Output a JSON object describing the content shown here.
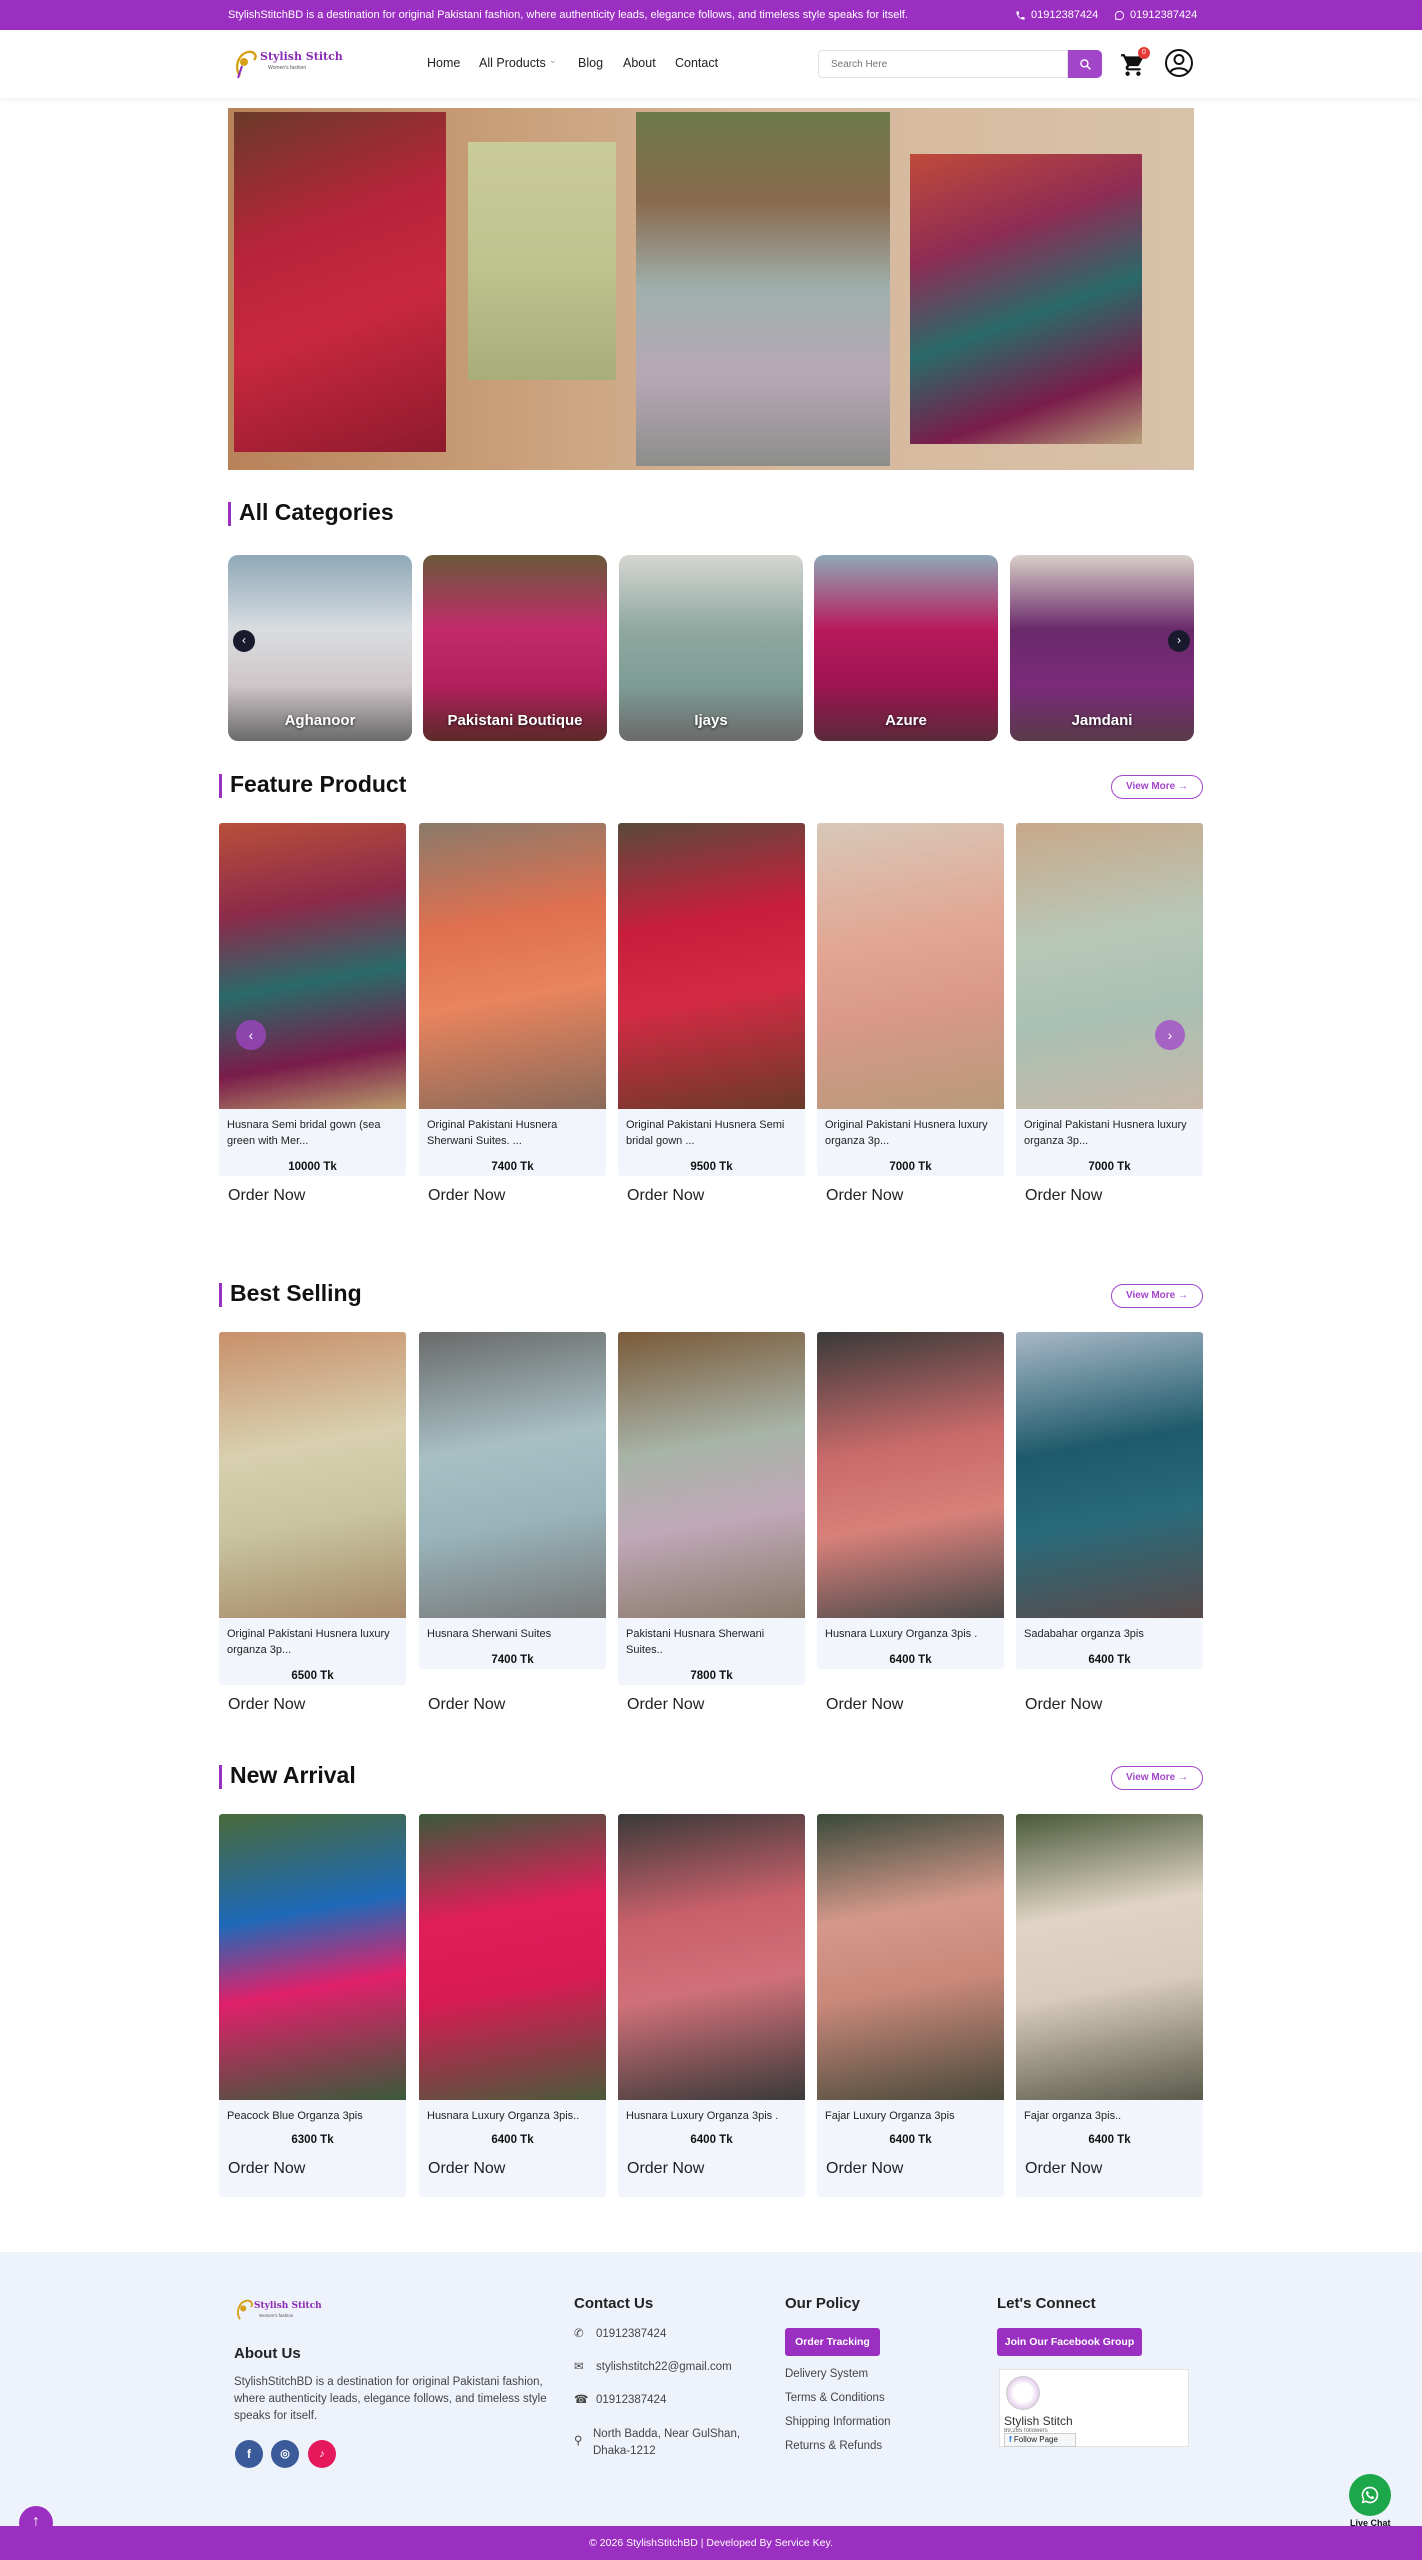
{
  "topbar": {
    "message": "StylishStitchBD is a destination for original Pakistani fashion, where authenticity leads, elegance follows, and timeless style speaks for itself.",
    "phone": "01912387424",
    "whatsapp": "01912387424"
  },
  "header": {
    "logo_text": "Stylish Stitch",
    "logo_sub": "Women's fashion",
    "nav": [
      "Home",
      "All Products",
      "Blog",
      "About",
      "Contact"
    ],
    "search_placeholder": "Search Here",
    "cart_count": "0"
  },
  "categories": {
    "title": "All Categories",
    "items": [
      "Aghanoor",
      "Pakistani Boutique",
      "Ijays",
      "Azure",
      "Jamdani"
    ]
  },
  "feature": {
    "title": "Feature Product",
    "view_more": "View More →",
    "products": [
      {
        "name": "Husnara Semi bridal gown (sea green with Mer...",
        "price": "10000 Tk",
        "order": "Order Now"
      },
      {
        "name": "Original Pakistani Husnera Sherwani Suites. ...",
        "price": "7400 Tk",
        "order": "Order Now"
      },
      {
        "name": "Original Pakistani Husnera Semi bridal gown ...",
        "price": "9500 Tk",
        "order": "Order Now"
      },
      {
        "name": "Original Pakistani Husnera luxury organza 3p...",
        "price": "7000 Tk",
        "order": "Order Now"
      },
      {
        "name": "Original Pakistani Husnera luxury organza 3p...",
        "price": "7000 Tk",
        "order": "Order Now"
      }
    ]
  },
  "best": {
    "title": "Best Selling",
    "view_more": "View More →",
    "products": [
      {
        "name": "Original Pakistani Husnera luxury organza 3p...",
        "price": "6500 Tk",
        "order": "Order Now"
      },
      {
        "name": "Husnara Sherwani Suites",
        "price": "7400 Tk",
        "order": "Order Now"
      },
      {
        "name": "Pakistani Husnara Sherwani Suites..",
        "price": "7800 Tk",
        "order": "Order Now"
      },
      {
        "name": "Husnara Luxury Organza 3pis .",
        "price": "6400 Tk",
        "order": "Order Now"
      },
      {
        "name": "Sadabahar organza 3pis",
        "price": "6400 Tk",
        "order": "Order Now"
      }
    ]
  },
  "arrival": {
    "title": "New Arrival",
    "view_more": "View More →",
    "products": [
      {
        "name": "Peacock Blue Organza 3pis",
        "price": "6300 Tk",
        "order": "Order Now"
      },
      {
        "name": "Husnara Luxury Organza 3pis..",
        "price": "6400 Tk",
        "order": "Order Now"
      },
      {
        "name": "Husnara Luxury Organza 3pis .",
        "price": "6400 Tk",
        "order": "Order Now"
      },
      {
        "name": "Fajar Luxury Organza 3pis",
        "price": "6400 Tk",
        "order": "Order Now"
      },
      {
        "name": "Fajar organza 3pis..",
        "price": "6400 Tk",
        "order": "Order Now"
      }
    ]
  },
  "footer": {
    "about_title": "About Us",
    "about_text": "StylishStitchBD is a destination for original Pakistani fashion, where authenticity leads, elegance follows, and timeless style speaks for itself.",
    "contact_title": "Contact Us",
    "whatsapp": "01912387424",
    "email": "stylishstitch22@gmail.com",
    "phone": "01912387424",
    "address": "North Badda, Near GulShan, Dhaka-1212",
    "policy_title": "Our Policy",
    "order_tracking": "Order Tracking",
    "policy_links": [
      "Delivery System",
      "Terms & Conditions",
      "Shipping Information",
      "Returns & Refunds"
    ],
    "connect_title": "Let's Connect",
    "fb_group": "Join Our Facebook Group",
    "fb_page_name": "Stylish Stitch",
    "fb_followers": "89,265 followers",
    "fb_follow": "Follow Page",
    "copyright": "© 2026 StylishStitchBD | Developed By Service Key.",
    "live_chat": "Live Chat"
  },
  "colors": {
    "brand": "#9b2fc1",
    "button": "#a246c9",
    "card_bg": "#f2f5fc"
  }
}
